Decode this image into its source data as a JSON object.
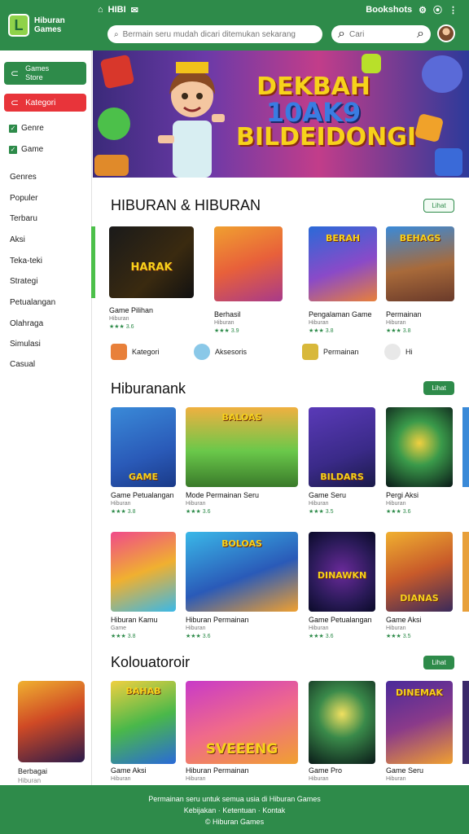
{
  "app": {
    "logo_text_line1": "Hiburan",
    "logo_text_line2": "Games",
    "logo_glyph": "L",
    "status_left": "HIBI",
    "status_right": "Bookshots",
    "search_placeholder": "Bermain seru mudah dicari ditemukan sekarang",
    "search_small_placeholder": "Cari"
  },
  "sidebar": {
    "primary_button": "Games\nStore",
    "red_button": "Kategori",
    "checks": [
      "Genre",
      "Game"
    ],
    "items": [
      "Genres",
      "Populer",
      "Terbaru",
      "Aksi",
      "Teka-teki",
      "Strategi",
      "Petualangan",
      "Olahraga",
      "Simulasi",
      "Casual"
    ],
    "promo_label": "Berbagai",
    "promo_sub": "Hiburan"
  },
  "hero": {
    "line1": "DEKBAH",
    "line2": "10AK9",
    "line3": "BILDEIDONGI"
  },
  "sections": [
    {
      "title": "HIBURAN & HIBURAN",
      "see_all": "Lihat",
      "cards": [
        {
          "name": "Game Pilihan",
          "sub": "Hiburan",
          "rating": "★★★ 3.6",
          "tag": "HARAK"
        },
        {
          "name": "Berhasil",
          "sub": "Hiburan",
          "rating": "★★★ 3.9",
          "tag": ""
        },
        {
          "name": "Pengalaman Game",
          "sub": "Hiburan",
          "rating": "★★★ 3.8",
          "tag": "BERAH"
        },
        {
          "name": "Permainan",
          "sub": "Hiburan",
          "rating": "★★★ 3.8",
          "tag": "BEHAGS"
        }
      ],
      "minis": [
        "Kategori",
        "Aksesoris",
        "Permainan",
        "Hi"
      ]
    },
    {
      "title": "Hiburanank",
      "see_all": "Lihat",
      "cards": [
        {
          "name": "Game Petualangan",
          "sub": "Hiburan",
          "rating": "★★★ 3.8",
          "tag": "GAME"
        },
        {
          "name": "Mode Permainan Seru",
          "sub": "Hiburan",
          "rating": "★★★ 3.6",
          "tag": "BALOAS"
        },
        {
          "name": "Game Seru",
          "sub": "Hiburan",
          "rating": "★★★ 3.5",
          "tag": "BILDARS"
        },
        {
          "name": "Pergi Aksi",
          "sub": "Hiburan",
          "rating": "★★★ 3.6",
          "tag": ""
        }
      ]
    },
    {
      "title": "",
      "see_all": "",
      "cards": [
        {
          "name": "Hiburan Kamu",
          "sub": "Game",
          "rating": "★★★ 3.8",
          "tag": ""
        },
        {
          "name": "Hiburan Permainan",
          "sub": "Hiburan",
          "rating": "★★★ 3.6",
          "tag": "BOLOAS"
        },
        {
          "name": "Game Petualangan",
          "sub": "Hiburan",
          "rating": "★★★ 3.6",
          "tag": "DINAWKN"
        },
        {
          "name": "Game Aksi",
          "sub": "Hiburan",
          "rating": "★★★ 3.5",
          "tag": "DIANAS"
        }
      ]
    },
    {
      "title": "Kolouatoroir",
      "see_all": "Lihat",
      "cards": [
        {
          "name": "Game Aksi",
          "sub": "Hiburan",
          "rating": "",
          "tag": "BAHAB"
        },
        {
          "name": "Hiburan Permainan",
          "sub": "Hiburan",
          "rating": "",
          "tag": "SVEEENG"
        },
        {
          "name": "Game Pro",
          "sub": "Hiburan",
          "rating": "",
          "tag": ""
        },
        {
          "name": "Game Seru",
          "sub": "Hiburan",
          "rating": "",
          "tag": "DINEMAK"
        }
      ]
    }
  ],
  "footer": {
    "line1": "Permainan seru untuk semua usia di Hiburan Games",
    "line2": "Kebijakan · Ketentuan · Kontak",
    "line3": "© Hiburan Games"
  },
  "colors": {
    "brand_green": "#2e8b4a",
    "accent_red": "#e8343a"
  }
}
